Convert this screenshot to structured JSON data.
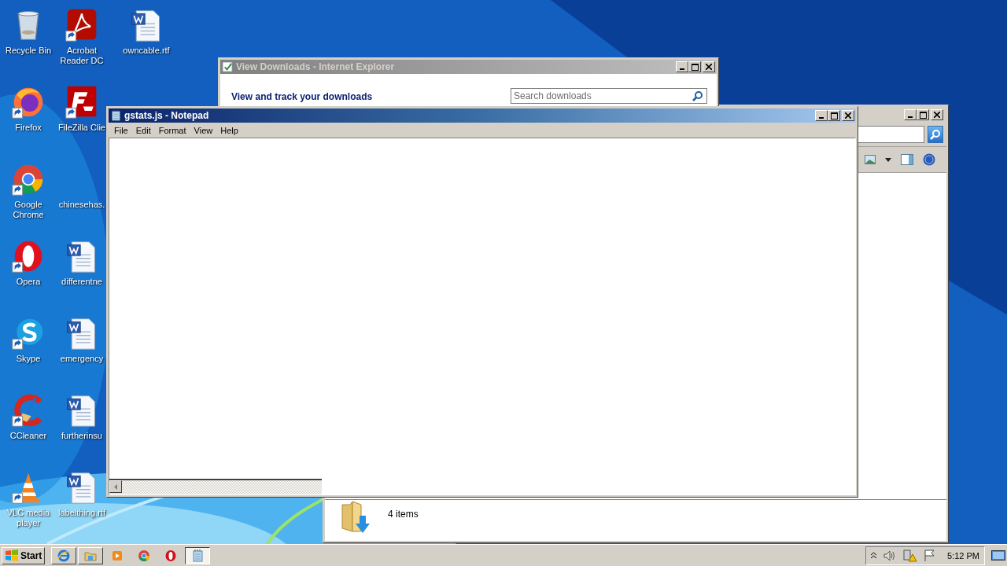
{
  "desktop_icons": [
    {
      "label": "Recycle Bin",
      "kind": "recycle",
      "shortcut": false
    },
    {
      "label": "Firefox",
      "kind": "firefox",
      "shortcut": true
    },
    {
      "label": "Google Chrome",
      "kind": "chrome",
      "shortcut": true
    },
    {
      "label": "Opera",
      "kind": "opera",
      "shortcut": true
    },
    {
      "label": "Skype",
      "kind": "skype",
      "shortcut": true
    },
    {
      "label": "CCleaner",
      "kind": "ccleaner",
      "shortcut": true
    },
    {
      "label": "VLC media player",
      "kind": "vlc",
      "shortcut": true
    },
    {
      "label": "Acrobat Reader DC",
      "kind": "pdf",
      "shortcut": true
    },
    {
      "label": "FileZilla Clie",
      "kind": "filezilla",
      "shortcut": true
    },
    {
      "label": "chinesehas.",
      "kind": "blank"
    },
    {
      "label": "differentne",
      "kind": "doc",
      "shortcut": false
    },
    {
      "label": "emergency",
      "kind": "doc",
      "shortcut": false
    },
    {
      "label": "furtherinsu",
      "kind": "doc",
      "shortcut": false
    },
    {
      "label": "labelthing.rtf",
      "kind": "doc",
      "shortcut": false
    },
    {
      "label": "owncable.rtf",
      "kind": "doc",
      "shortcut": false
    }
  ],
  "explorer_window": {
    "status": "4 items"
  },
  "downloads_window": {
    "title": "View Downloads - Internet Explorer",
    "heading": "View and track your downloads",
    "search": {
      "placeholder": "Search downloads"
    }
  },
  "notepad_window": {
    "title": "gstats.js - Notepad",
    "menu": [
      "File",
      "Edit",
      "Format",
      "View",
      "Help"
    ]
  },
  "taskbar": {
    "start": "Start",
    "items": [
      {
        "kind": "ie",
        "open": true,
        "selected": false
      },
      {
        "kind": "folder",
        "open": true,
        "selected": false
      },
      {
        "kind": "media",
        "open": false,
        "selected": false
      },
      {
        "kind": "chrome",
        "open": false,
        "selected": false
      },
      {
        "kind": "opera",
        "open": false,
        "selected": false
      },
      {
        "kind": "notepad",
        "open": true,
        "selected": true
      }
    ],
    "clock": "5:12 PM"
  }
}
